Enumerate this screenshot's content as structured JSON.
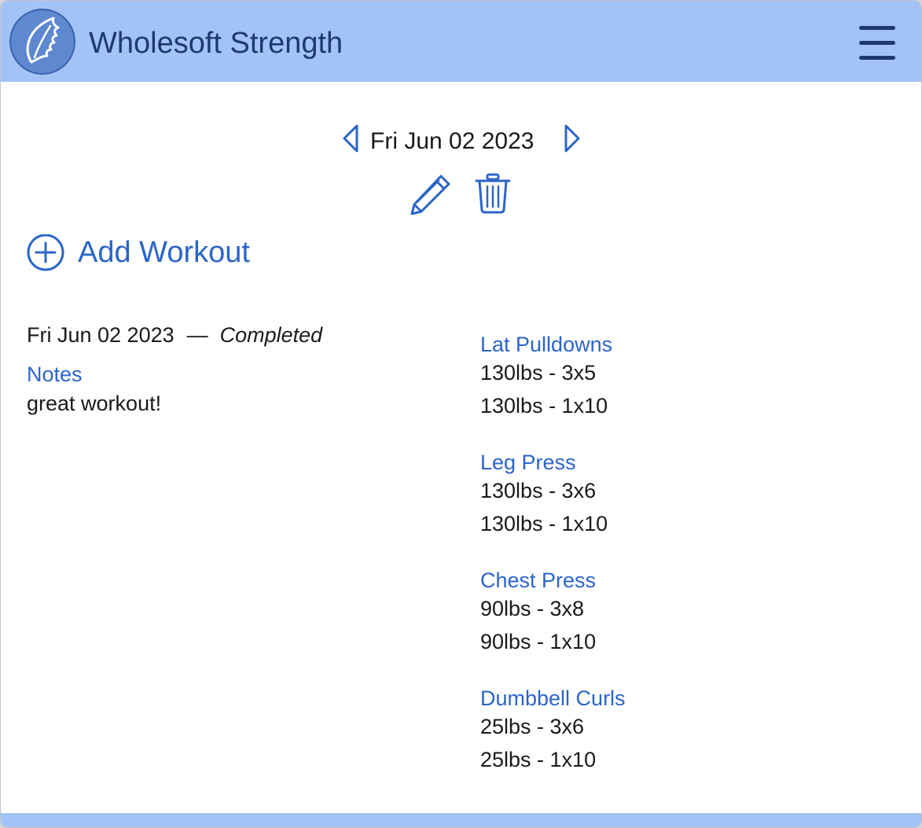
{
  "app": {
    "title": "Wholesoft Strength",
    "logo_icon": "leaf-icon",
    "menu_icon": "hamburger-menu-icon"
  },
  "colors": {
    "header_bg": "#a3c3f6",
    "title_text": "#1d3a6e",
    "accent": "#2c65c9",
    "body_text": "#1a1a1a"
  },
  "date_nav": {
    "current_date": "Fri Jun 02 2023",
    "prev_icon": "chevron-left-icon",
    "next_icon": "chevron-right-icon",
    "edit_icon": "pencil-icon",
    "delete_icon": "trash-icon"
  },
  "add_workout": {
    "label": "Add Workout",
    "icon": "plus-circle-icon"
  },
  "workout": {
    "date": "Fri Jun 02 2023",
    "separator": "—",
    "status": "Completed",
    "notes_label": "Notes",
    "notes": "great workout!",
    "exercises": [
      {
        "name": "Lat Pulldowns",
        "sets": [
          "130lbs - 3x5",
          "130lbs - 1x10"
        ]
      },
      {
        "name": "Leg Press",
        "sets": [
          "130lbs - 3x6",
          "130lbs - 1x10"
        ]
      },
      {
        "name": "Chest Press",
        "sets": [
          "90lbs - 3x8",
          "90lbs - 1x10"
        ]
      },
      {
        "name": "Dumbbell Curls",
        "sets": [
          "25lbs - 3x6",
          "25lbs - 1x10"
        ]
      }
    ]
  }
}
